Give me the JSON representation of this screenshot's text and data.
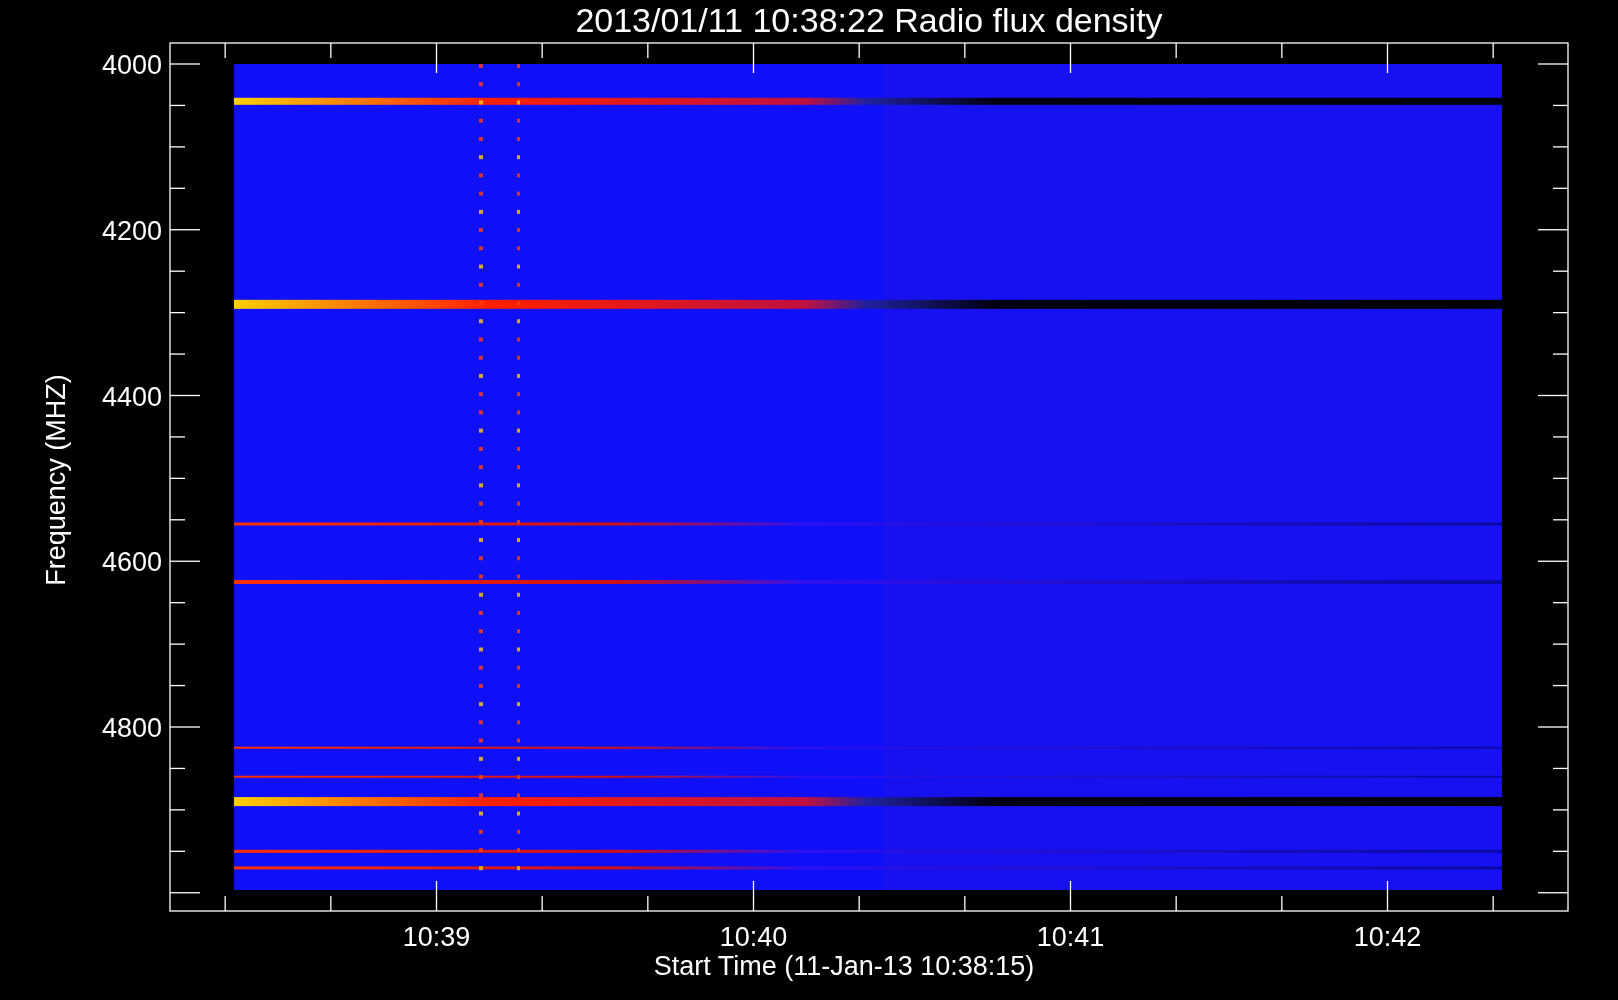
{
  "title": "2013/01/11 10:38:22 Radio flux density",
  "ylabel": "Frequency (MHZ)",
  "xlabel": "Start Time (11-Jan-13 10:38:15)",
  "y_tick_labels": [
    "4000",
    "4200",
    "4400",
    "4600",
    "4800"
  ],
  "x_tick_labels": [
    "10:39",
    "10:40",
    "10:41",
    "10:42"
  ]
}
